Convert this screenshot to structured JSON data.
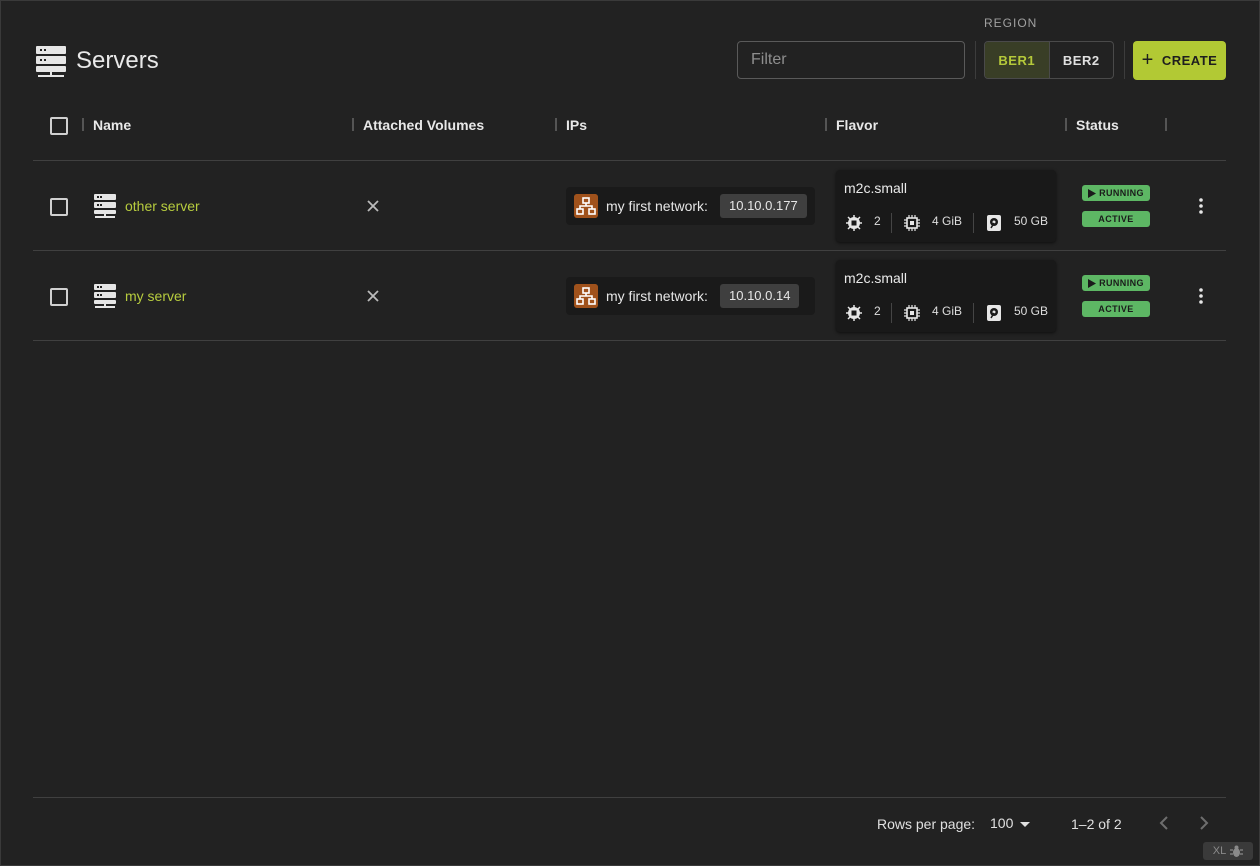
{
  "header": {
    "title": "Servers",
    "filter_placeholder": "Filter",
    "region_label": "REGION",
    "regions": [
      {
        "label": "BER1",
        "selected": true
      },
      {
        "label": "BER2",
        "selected": false
      }
    ],
    "create_label": "CREATE"
  },
  "table": {
    "columns": [
      "Name",
      "Attached Volumes",
      "IPs",
      "Flavor",
      "Status"
    ],
    "rows": [
      {
        "name": "other server",
        "network": "my first network:",
        "ip": "10.10.0.177",
        "flavor": "m2c.small",
        "cpu": "2",
        "ram": "4 GiB",
        "disk": "50 GB",
        "run_status": "RUNNING",
        "state": "ACTIVE"
      },
      {
        "name": "my server",
        "network": "my first network:",
        "ip": "10.10.0.14",
        "flavor": "m2c.small",
        "cpu": "2",
        "ram": "4 GiB",
        "disk": "50 GB",
        "run_status": "RUNNING",
        "state": "ACTIVE"
      }
    ]
  },
  "footer": {
    "rows_per_page_label": "Rows per page:",
    "rows_per_page_value": "100",
    "range": "1–2 of 2",
    "size_badge": "XL"
  },
  "colors": {
    "accent": "#b2c934",
    "link": "#b7cc3e",
    "status_green": "#5db764",
    "network_icon": "#a0521c",
    "background": "#222222"
  }
}
